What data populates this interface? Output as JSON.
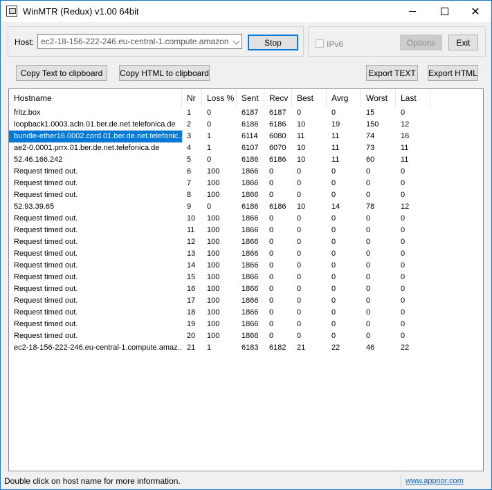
{
  "window": {
    "title": "WinMTR (Redux) v1.00 64bit",
    "accent": "#0078d7"
  },
  "host": {
    "label": "Host:",
    "value": "ec2-18-156-222-246.eu-central-1.compute.amazonaws.co",
    "stop_label": "Stop",
    "ipv6_label": "IPv6",
    "ipv6_checked": false,
    "options_label": "Options",
    "exit_label": "Exit"
  },
  "toolbar": {
    "copy_text_label": "Copy Text to clipboard",
    "copy_html_label": "Copy HTML to clipboard",
    "export_text_label": "Export TEXT",
    "export_html_label": "Export HTML"
  },
  "table": {
    "columns": [
      "Hostname",
      "Nr",
      "Loss %",
      "Sent",
      "Recv",
      "Best",
      "Avrg",
      "Worst",
      "Last"
    ],
    "selected_index": 2,
    "rows": [
      [
        "fritz.box",
        "1",
        "0",
        "6187",
        "6187",
        "0",
        "0",
        "15",
        "0"
      ],
      [
        "loopback1.0003.acln.01.ber.de.net.telefonica.de",
        "2",
        "0",
        "6186",
        "6186",
        "10",
        "19",
        "150",
        "12"
      ],
      [
        "bundle-ether16.0002.cord.01.ber.de.net.telefonic...",
        "3",
        "1",
        "6114",
        "6080",
        "11",
        "11",
        "74",
        "16"
      ],
      [
        "ae2-0.0001.prrx.01.ber.de.net.telefonica.de",
        "4",
        "1",
        "6107",
        "6070",
        "10",
        "11",
        "73",
        "11"
      ],
      [
        "52.46.166.242",
        "5",
        "0",
        "6186",
        "6186",
        "10",
        "11",
        "60",
        "11"
      ],
      [
        "Request timed out.",
        "6",
        "100",
        "1866",
        "0",
        "0",
        "0",
        "0",
        "0"
      ],
      [
        "Request timed out.",
        "7",
        "100",
        "1866",
        "0",
        "0",
        "0",
        "0",
        "0"
      ],
      [
        "Request timed out.",
        "8",
        "100",
        "1866",
        "0",
        "0",
        "0",
        "0",
        "0"
      ],
      [
        "52.93.39.65",
        "9",
        "0",
        "6186",
        "6186",
        "10",
        "14",
        "78",
        "12"
      ],
      [
        "Request timed out.",
        "10",
        "100",
        "1866",
        "0",
        "0",
        "0",
        "0",
        "0"
      ],
      [
        "Request timed out.",
        "11",
        "100",
        "1866",
        "0",
        "0",
        "0",
        "0",
        "0"
      ],
      [
        "Request timed out.",
        "12",
        "100",
        "1866",
        "0",
        "0",
        "0",
        "0",
        "0"
      ],
      [
        "Request timed out.",
        "13",
        "100",
        "1866",
        "0",
        "0",
        "0",
        "0",
        "0"
      ],
      [
        "Request timed out.",
        "14",
        "100",
        "1866",
        "0",
        "0",
        "0",
        "0",
        "0"
      ],
      [
        "Request timed out.",
        "15",
        "100",
        "1866",
        "0",
        "0",
        "0",
        "0",
        "0"
      ],
      [
        "Request timed out.",
        "16",
        "100",
        "1866",
        "0",
        "0",
        "0",
        "0",
        "0"
      ],
      [
        "Request timed out.",
        "17",
        "100",
        "1866",
        "0",
        "0",
        "0",
        "0",
        "0"
      ],
      [
        "Request timed out.",
        "18",
        "100",
        "1866",
        "0",
        "0",
        "0",
        "0",
        "0"
      ],
      [
        "Request timed out.",
        "19",
        "100",
        "1866",
        "0",
        "0",
        "0",
        "0",
        "0"
      ],
      [
        "Request timed out.",
        "20",
        "100",
        "1866",
        "0",
        "0",
        "0",
        "0",
        "0"
      ],
      [
        "ec2-18-156-222-246.eu-central-1.compute.amaz...",
        "21",
        "1",
        "6183",
        "6182",
        "21",
        "22",
        "46",
        "22"
      ]
    ]
  },
  "status": {
    "text": "Double click on host name for more information.",
    "link": "www.appnor.com"
  },
  "icons": {
    "app": "app-icon",
    "minimize": "minimize-icon",
    "maximize": "maximize-icon",
    "close": "close-icon",
    "dropdown": "chevron-down-icon"
  }
}
